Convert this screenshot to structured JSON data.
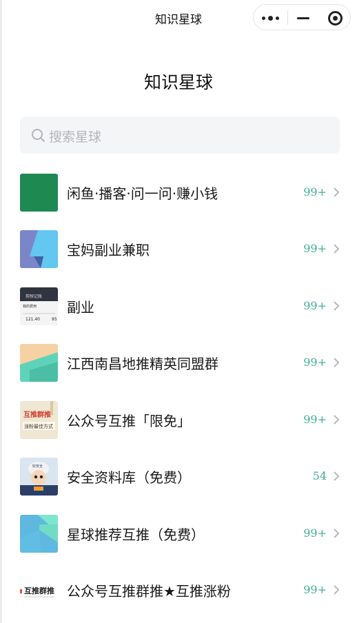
{
  "nav": {
    "title": "知识星球"
  },
  "capsule": {
    "more_icon": "more-dots-icon",
    "minimize_icon": "minimize-icon",
    "close_icon": "target-close-icon"
  },
  "page": {
    "heading": "知识星球"
  },
  "search": {
    "placeholder": "搜索星球",
    "icon": "search-icon"
  },
  "planets": [
    {
      "name": "闲鱼·播客·问一问·赚小钱",
      "count": "99+"
    },
    {
      "name": "宝妈副业兼职",
      "count": "99+"
    },
    {
      "name": "副业",
      "count": "99+",
      "thumb_text": [
        "剪映记账",
        "我的费用",
        "121.40",
        "95"
      ]
    },
    {
      "name": "江西南昌地推精英同盟群",
      "count": "99+"
    },
    {
      "name": "公众号互推「限免」",
      "count": "99+",
      "thumb_text": [
        "互推群推",
        "涨粉最佳方式"
      ]
    },
    {
      "name": "安全资料库（免费）",
      "count": "54",
      "thumb_text": [
        "好安全"
      ]
    },
    {
      "name": "星球推荐互推（免费）",
      "count": "99+"
    },
    {
      "name": "公众号互推群推★互推涨粉",
      "count": "99+",
      "thumb_text": [
        "互推群推"
      ]
    }
  ],
  "colors": {
    "accent": "#3fae94",
    "search_bg": "#f3f5f7"
  }
}
